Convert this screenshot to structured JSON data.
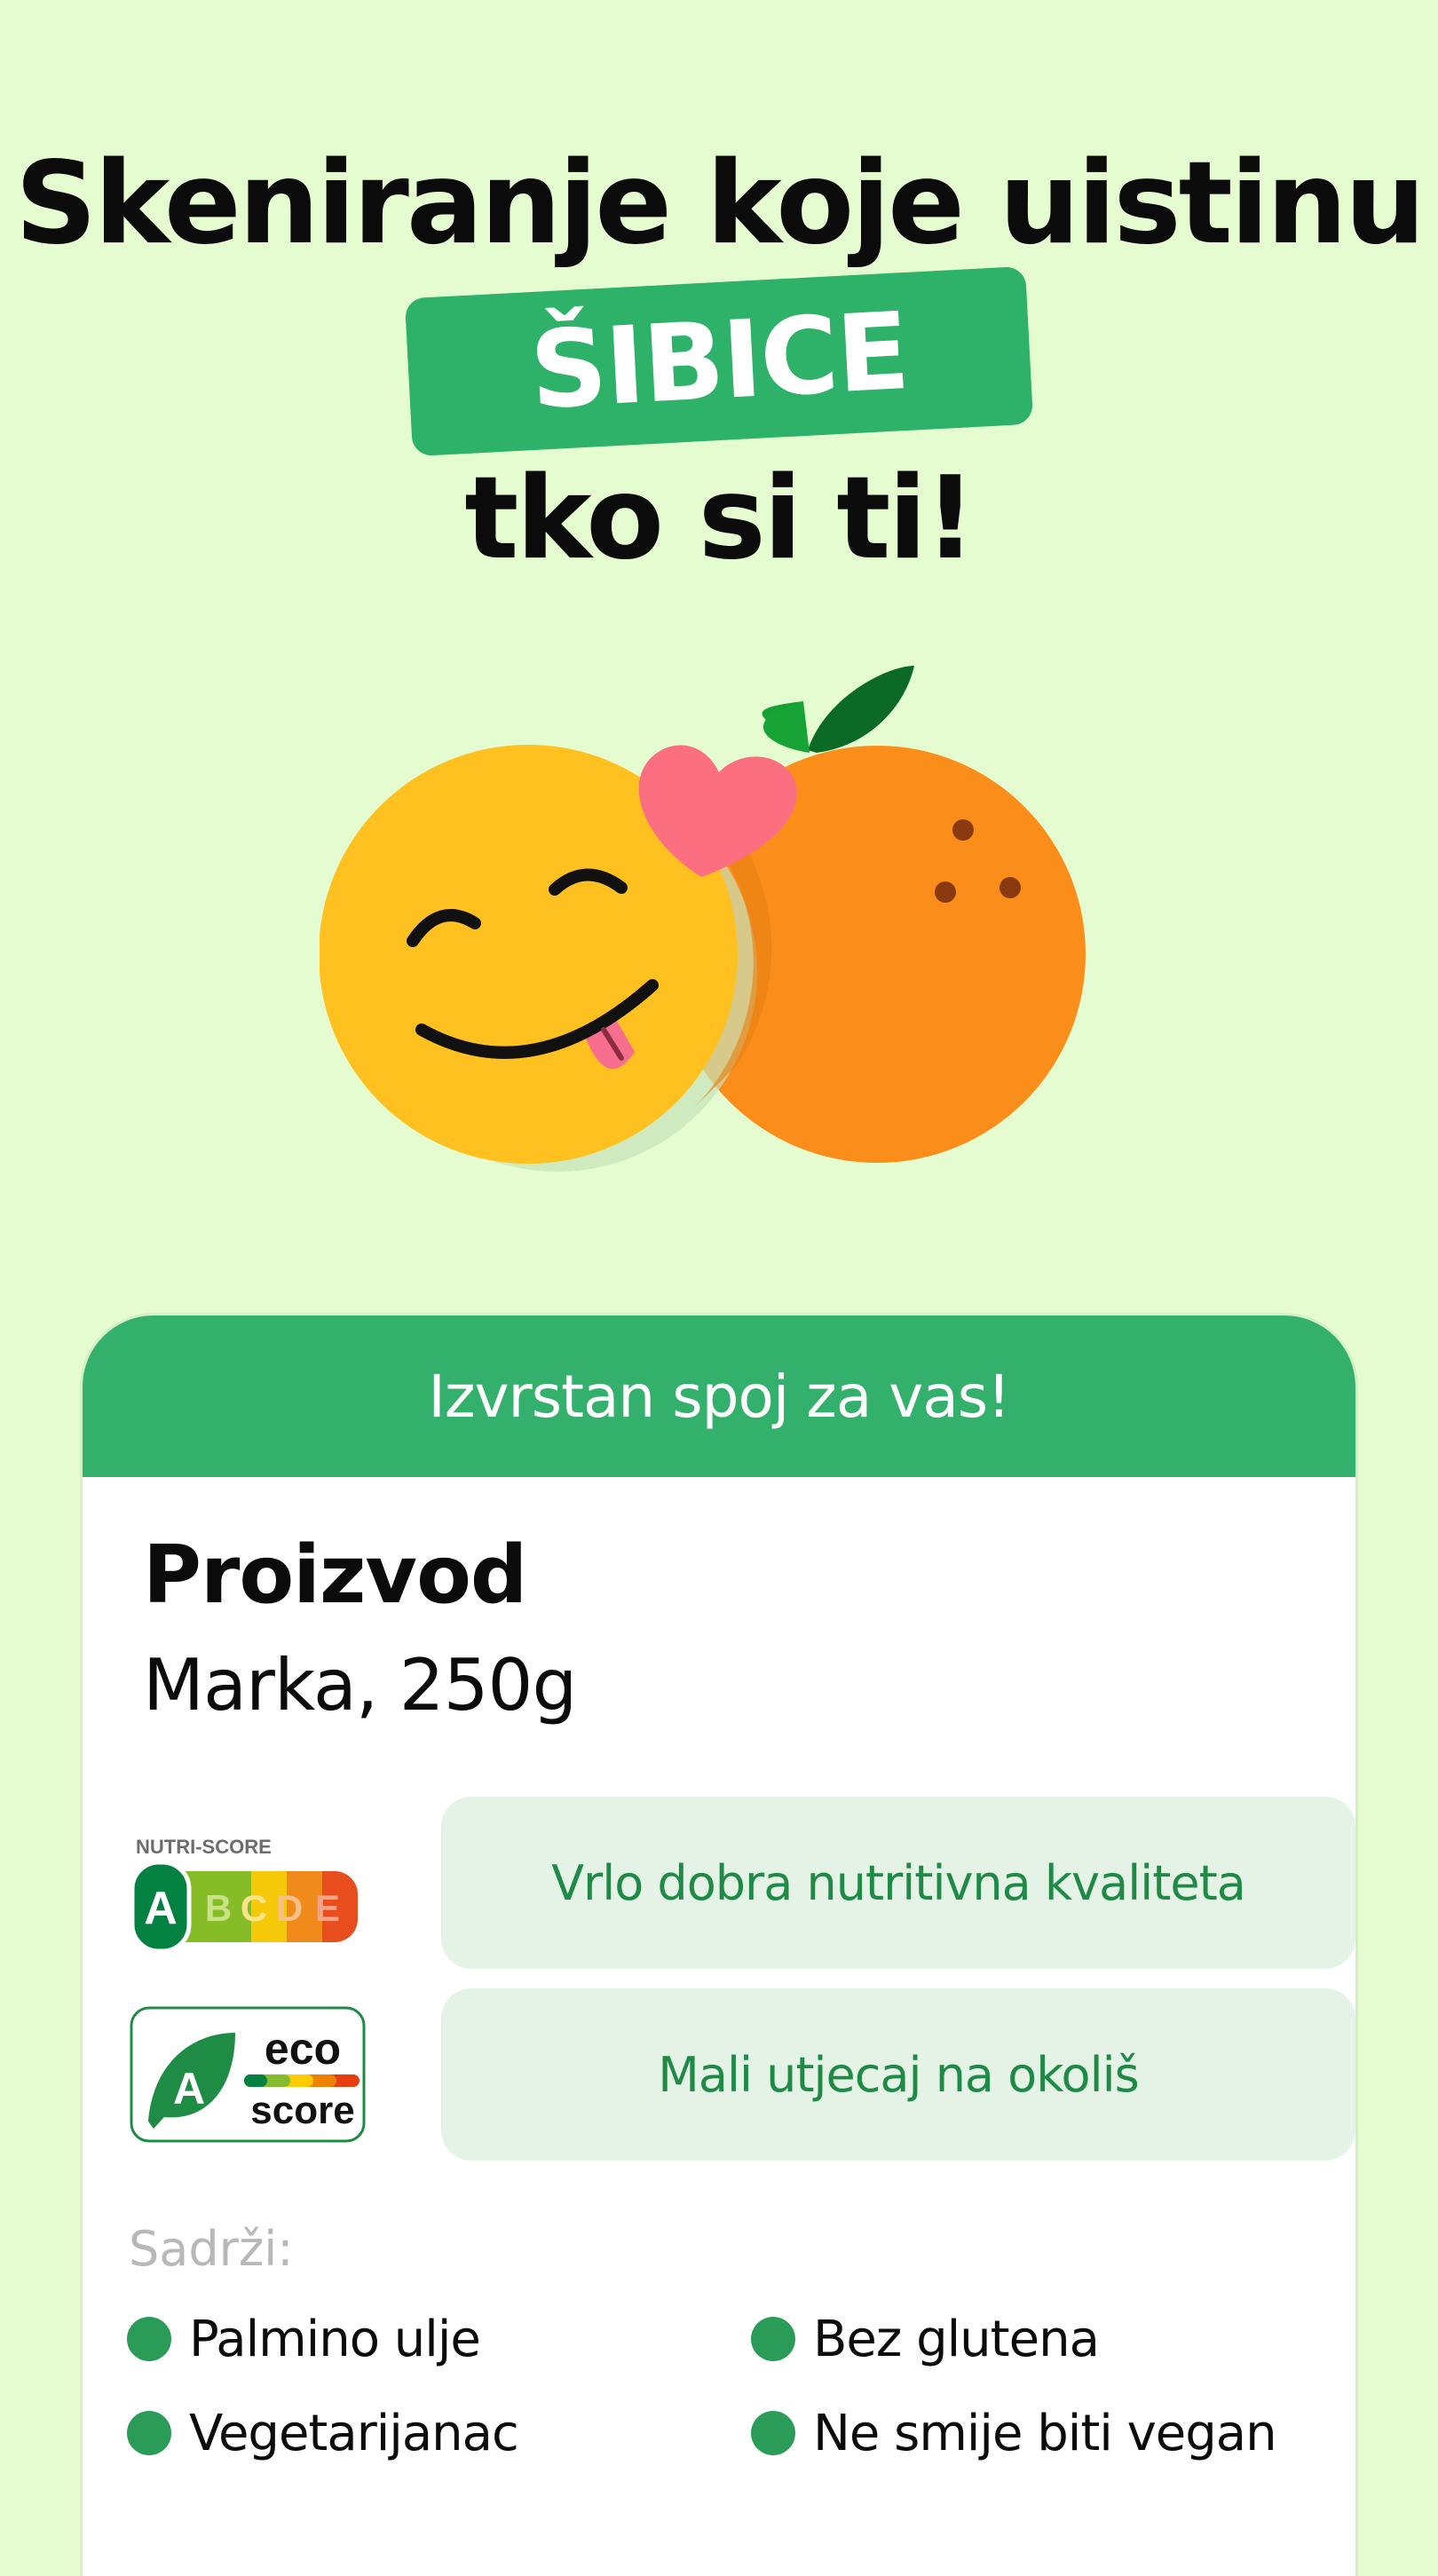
{
  "headline": {
    "line1": "Skeniranje koje uistinu",
    "highlight": "ŠIBICE",
    "line3": "tko si ti!"
  },
  "card": {
    "header": "Izvrstan spoj za vas!",
    "product_name": "Proizvod",
    "product_meta": "Marka, 250g",
    "nutri_score": {
      "logo_title": "NUTRI-SCORE",
      "grades": [
        "A",
        "B",
        "C",
        "D",
        "E"
      ],
      "selected": "A",
      "text": "Vrlo dobra nutritivna kvaliteta"
    },
    "eco_score": {
      "grade": "A",
      "logo_line1": "eco",
      "logo_line2": "score",
      "text": "Mali utjecaj na okoliš"
    },
    "contains_label": "Sadrži:",
    "tags": [
      "Palmino ulje",
      "Bez glutena",
      "Vegetarijanac",
      "Ne smije biti vegan"
    ]
  },
  "colors": {
    "background": "#e5fcd0",
    "brand_green": "#33b06b",
    "pill_bg": "#e5f3e7",
    "pill_text": "#1f8a46"
  },
  "icons": [
    "smiley-tongue-icon",
    "heart-icon",
    "orange-fruit-icon",
    "leaf-icon"
  ]
}
